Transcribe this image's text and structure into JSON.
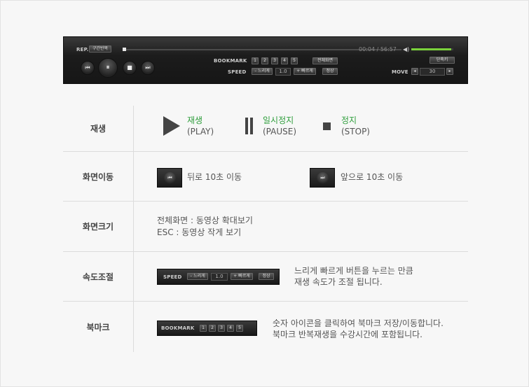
{
  "player": {
    "rep_label": "REP.",
    "section_repeat_button": "구간반복",
    "time": "00:04 / 56:57",
    "volume_icon": "speaker-icon",
    "volume_level": 0.95,
    "bookmark_label": "BOOKMARK",
    "bookmark_numbers": [
      "1",
      "2",
      "3",
      "4",
      "5"
    ],
    "fullscreen_button": "전체화면",
    "speed_label": "SPEED",
    "slower_button": "– 느리게",
    "speed_value": "1.0",
    "faster_button": "+ 빠르게",
    "normal_button": "정상",
    "shortcut_button": "단축키",
    "move_label": "MOVE",
    "move_value": "30",
    "move_prev": "◂",
    "move_next": "▸",
    "controls": {
      "prev": "⏮",
      "pause": "⏸",
      "stop": "■",
      "next": "⏭"
    },
    "accent_color": "#7bd33c"
  },
  "rows": {
    "play": {
      "label": "재생",
      "items": [
        {
          "title": "재생",
          "sub": "(PLAY)"
        },
        {
          "title": "일시정지",
          "sub": "(PAUSE)"
        },
        {
          "title": "정지",
          "sub": "(STOP)"
        }
      ]
    },
    "seek": {
      "label": "화면이동",
      "back_text": "뒤로 10초 이동",
      "forward_text": "앞으로 10초 이동"
    },
    "size": {
      "label": "화면크기",
      "line1": "전체화면 : 동영상 확대보기",
      "line2": "ESC : 동영상 작게 보기"
    },
    "speed": {
      "label": "속도조절",
      "line1": "느리게 빠르게 버튼을 누르는 만큼",
      "line2": "재생 속도가 조절 됩니다."
    },
    "bookmark": {
      "label": "북마크",
      "line1": "숫자 아이콘을 클릭하여 북마크 저장/이동합니다.",
      "line2": "북마크 반복재생을 수강시간에 포함됩니다."
    }
  }
}
